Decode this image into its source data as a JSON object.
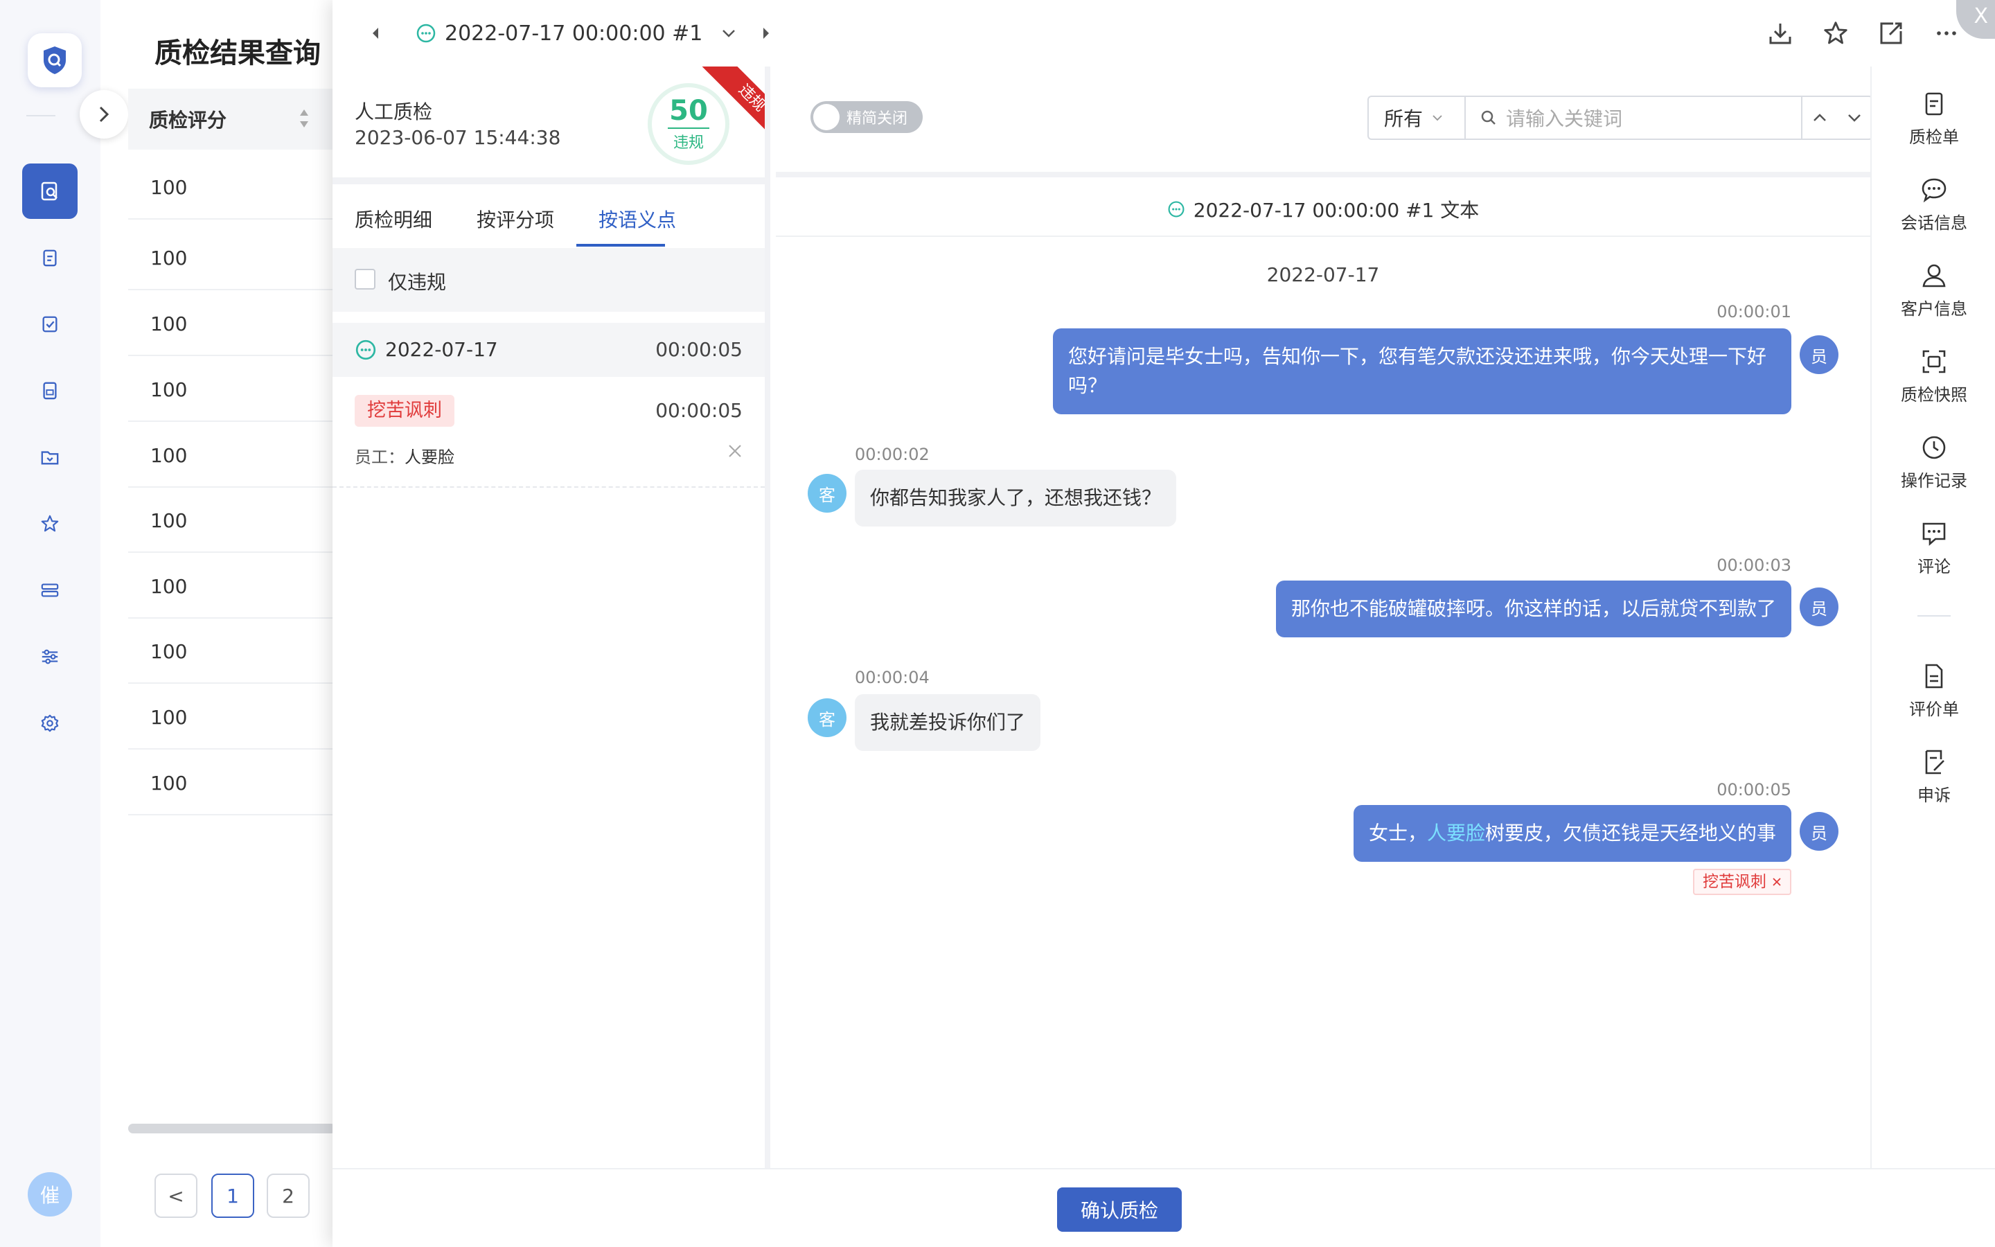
{
  "page": {
    "title": "质检结果查询"
  },
  "sidebar_bottom_avatar": "催",
  "table": {
    "column_header": "质检评分",
    "rows": [
      "100",
      "100",
      "100",
      "100",
      "100",
      "100",
      "100",
      "100",
      "100",
      "100"
    ]
  },
  "pagination": {
    "prev": "<",
    "pages": [
      "1",
      "2"
    ],
    "current": "1"
  },
  "drawer": {
    "record_title": "2022-07-17 00:00:00 #1",
    "inspection_type": "人工质检",
    "inspection_time": "2023-06-07 15:44:38",
    "score": "50",
    "score_label": "违规",
    "ribbon": "违规",
    "tabs": [
      "质检明细",
      "按评分项",
      "按语义点"
    ],
    "active_tab": 2,
    "filter_label": "仅违规",
    "segment": {
      "date": "2022-07-17",
      "duration": "00:00:05"
    },
    "hit": {
      "tag": "挖苦讽刺",
      "duration": "00:00:05",
      "staff_label": "员工：",
      "staff_name": "人要脸"
    }
  },
  "chat": {
    "toggle_label": "精简关闭",
    "filter_select": "所有",
    "search_placeholder": "请输入关键词",
    "title": "2022-07-17 00:00:00 #1 文本",
    "date": "2022-07-17",
    "agent_avatar": "员",
    "customer_avatar": "客",
    "messages": [
      {
        "time": "00:00:01",
        "text": "您好请问是毕女士吗，告知你一下，您有笔欠款还没还进来哦，你今天处理一下好吗？"
      },
      {
        "time": "00:00:02",
        "text": "你都告知我家人了，还想我还钱？"
      },
      {
        "time": "00:00:03",
        "text": "那你也不能破罐破摔呀。你这样的话，以后就贷不到款了"
      },
      {
        "time": "00:00:04",
        "text": "我就差投诉你们了"
      },
      {
        "time": "00:00:05",
        "pre": "女士，",
        "highlight": "人要脸",
        "post": "树要皮，欠债还钱是天经地义的事",
        "tag": "挖苦讽刺"
      }
    ]
  },
  "right_sidebar": [
    "质检单",
    "会话信息",
    "客户信息",
    "质检快照",
    "操作记录",
    "评论",
    "评价单",
    "申诉"
  ],
  "confirm_button": "确认质检",
  "close_glyph": "X",
  "colors": {
    "primary": "#3b63c4",
    "agent_bubble": "#5b80d6",
    "violation": "#d72a2a",
    "score": "#2db783"
  }
}
